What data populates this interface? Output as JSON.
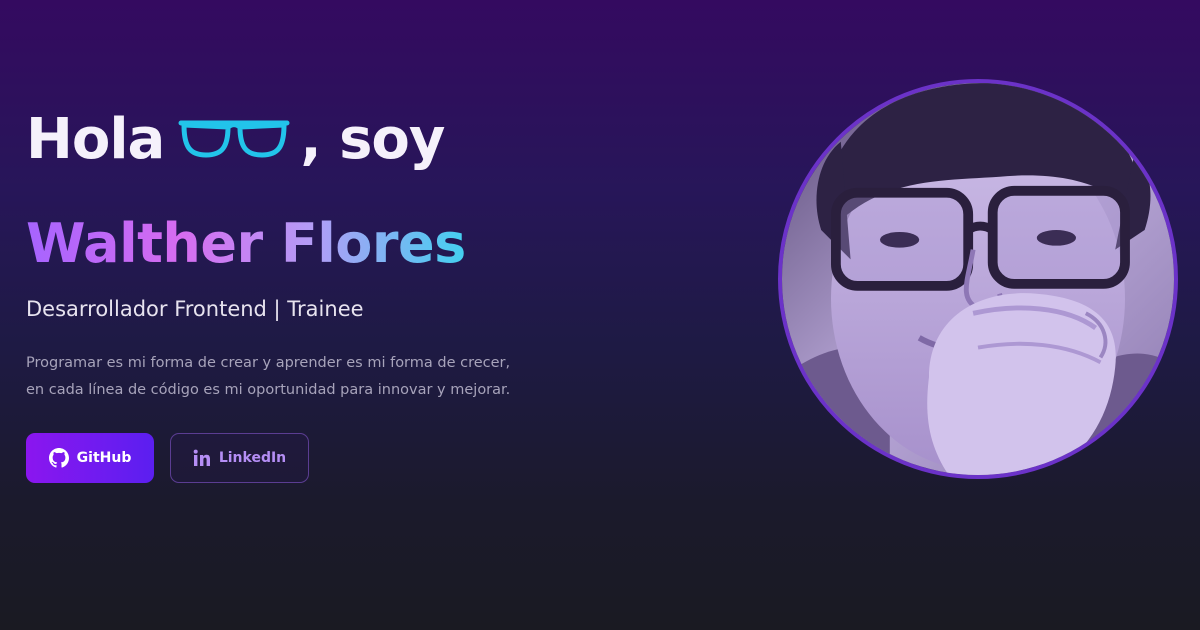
{
  "hero": {
    "greeting_before": "Hola",
    "greeting_after": ", soy",
    "glasses_icon": "glasses-emoji-icon",
    "name": "Walther Flores",
    "role": "Desarrollador Frontend | Trainee",
    "description": "Programar es mi forma de crear y aprender es mi forma de crecer, en cada línea de código es mi oportunidad para innovar y mejorar."
  },
  "buttons": {
    "github_label": "GitHub",
    "github_icon": "github-icon",
    "linkedin_label": "LinkedIn",
    "linkedin_icon": "linkedin-icon"
  },
  "profile_photo": {
    "icon": "profile-photo"
  },
  "colors": {
    "accent": "#8b16ef",
    "name_gradient": [
      "#a664ff",
      "#d66cf0",
      "#43d0f0"
    ],
    "glasses": "#22c4ea",
    "ring": "#6b32c8"
  }
}
